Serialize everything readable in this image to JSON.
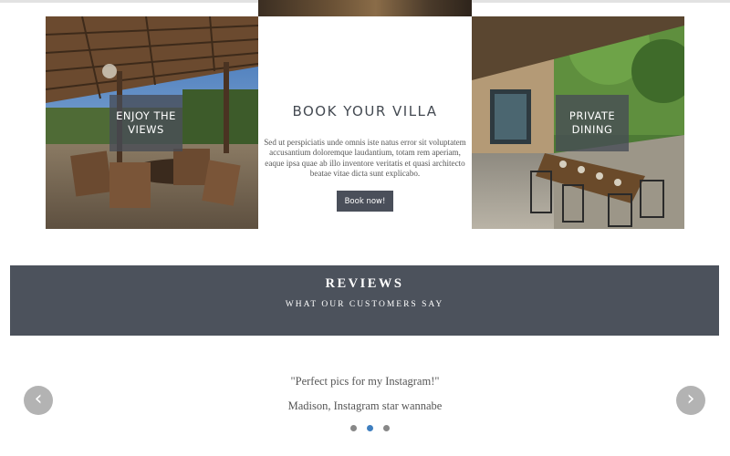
{
  "hero": {
    "left_label": "ENJOY THE VIEWS",
    "right_label": "PRIVATE DINING",
    "book": {
      "title": "BOOK YOUR VILLA",
      "description": "Sed ut perspiciatis unde omnis iste natus error sit voluptatem accusantium doloremque laudantium, totam rem aperiam, eaque ipsa quae ab illo inventore veritatis et quasi architecto beatae vitae dicta sunt explicabo.",
      "button_label": "Book now!"
    }
  },
  "reviews": {
    "title": "REVIEWS",
    "subtitle": "WHAT OUR CUSTOMERS SAY"
  },
  "testimonial": {
    "quote": "\"Perfect pics for my Instagram!\"",
    "author": "Madison, Instagram star wannabe",
    "prev_arrow": "‹",
    "next_arrow": "›",
    "slide_count": 3,
    "active_slide": 2
  },
  "colors": {
    "banner": "#4c525c",
    "button": "#4a4f5a",
    "active_dot": "#3f7fbf",
    "inactive_dot": "#888888",
    "arrow": "#b3b3b3"
  }
}
